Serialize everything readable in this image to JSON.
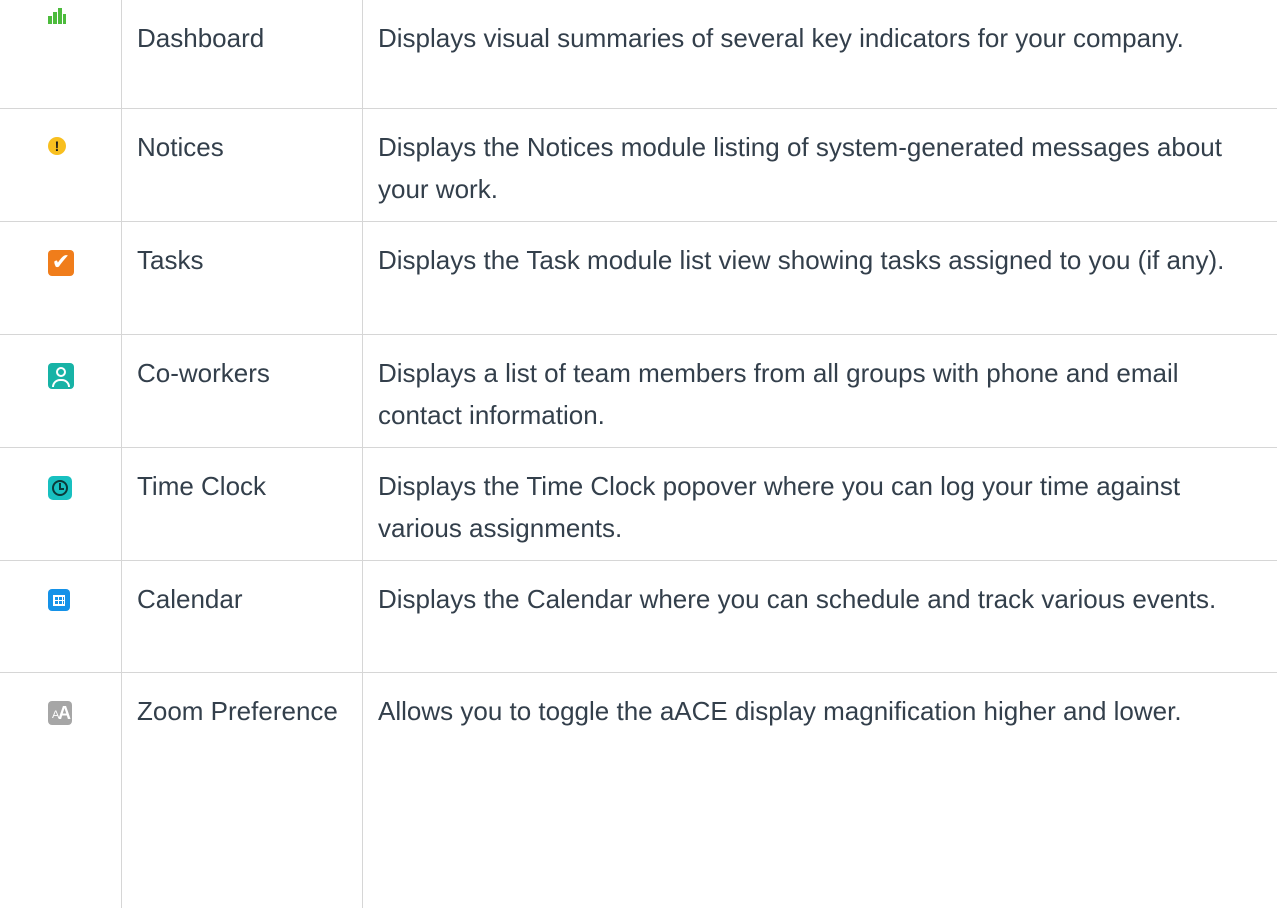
{
  "colors": {
    "text": "#333f4b",
    "border": "#d6d6d6",
    "dashboard_icon": "#4cbb3c",
    "notices_icon": "#f8bf1f",
    "tasks_icon": "#f07d1b",
    "coworkers_icon": "#17b3a6",
    "timeclock_icon": "#18c0c0",
    "calendar_icon": "#1592e8",
    "zoom_icon": "#a6a6a6"
  },
  "rows": [
    {
      "icon": "bar-chart-icon",
      "name": "Dashboard",
      "description": "Displays visual summaries of several key indicators for your company."
    },
    {
      "icon": "exclamation-circle-icon",
      "icon_glyph": "!",
      "name": "Notices",
      "description": "Displays the Notices module listing of system-generated messages about your work."
    },
    {
      "icon": "checkmark-square-icon",
      "icon_glyph": "✔",
      "name": "Tasks",
      "description": "Displays the Task module list view showing tasks assigned to you (if any)."
    },
    {
      "icon": "person-icon",
      "name": "Co-workers",
      "description": "Displays a list of team members from all groups with phone and email contact information."
    },
    {
      "icon": "clock-icon",
      "name": "Time Clock",
      "description": "Displays the Time Clock popover where you can log your time against various assignments."
    },
    {
      "icon": "calendar-icon",
      "name": "Calendar",
      "description": "Displays the Calendar where you can schedule and track various events."
    },
    {
      "icon": "text-size-icon",
      "icon_glyph_small": "A",
      "icon_glyph_large": "A",
      "name": "Zoom Preference",
      "description": "Allows you to toggle the aACE display magnification higher and lower."
    }
  ]
}
